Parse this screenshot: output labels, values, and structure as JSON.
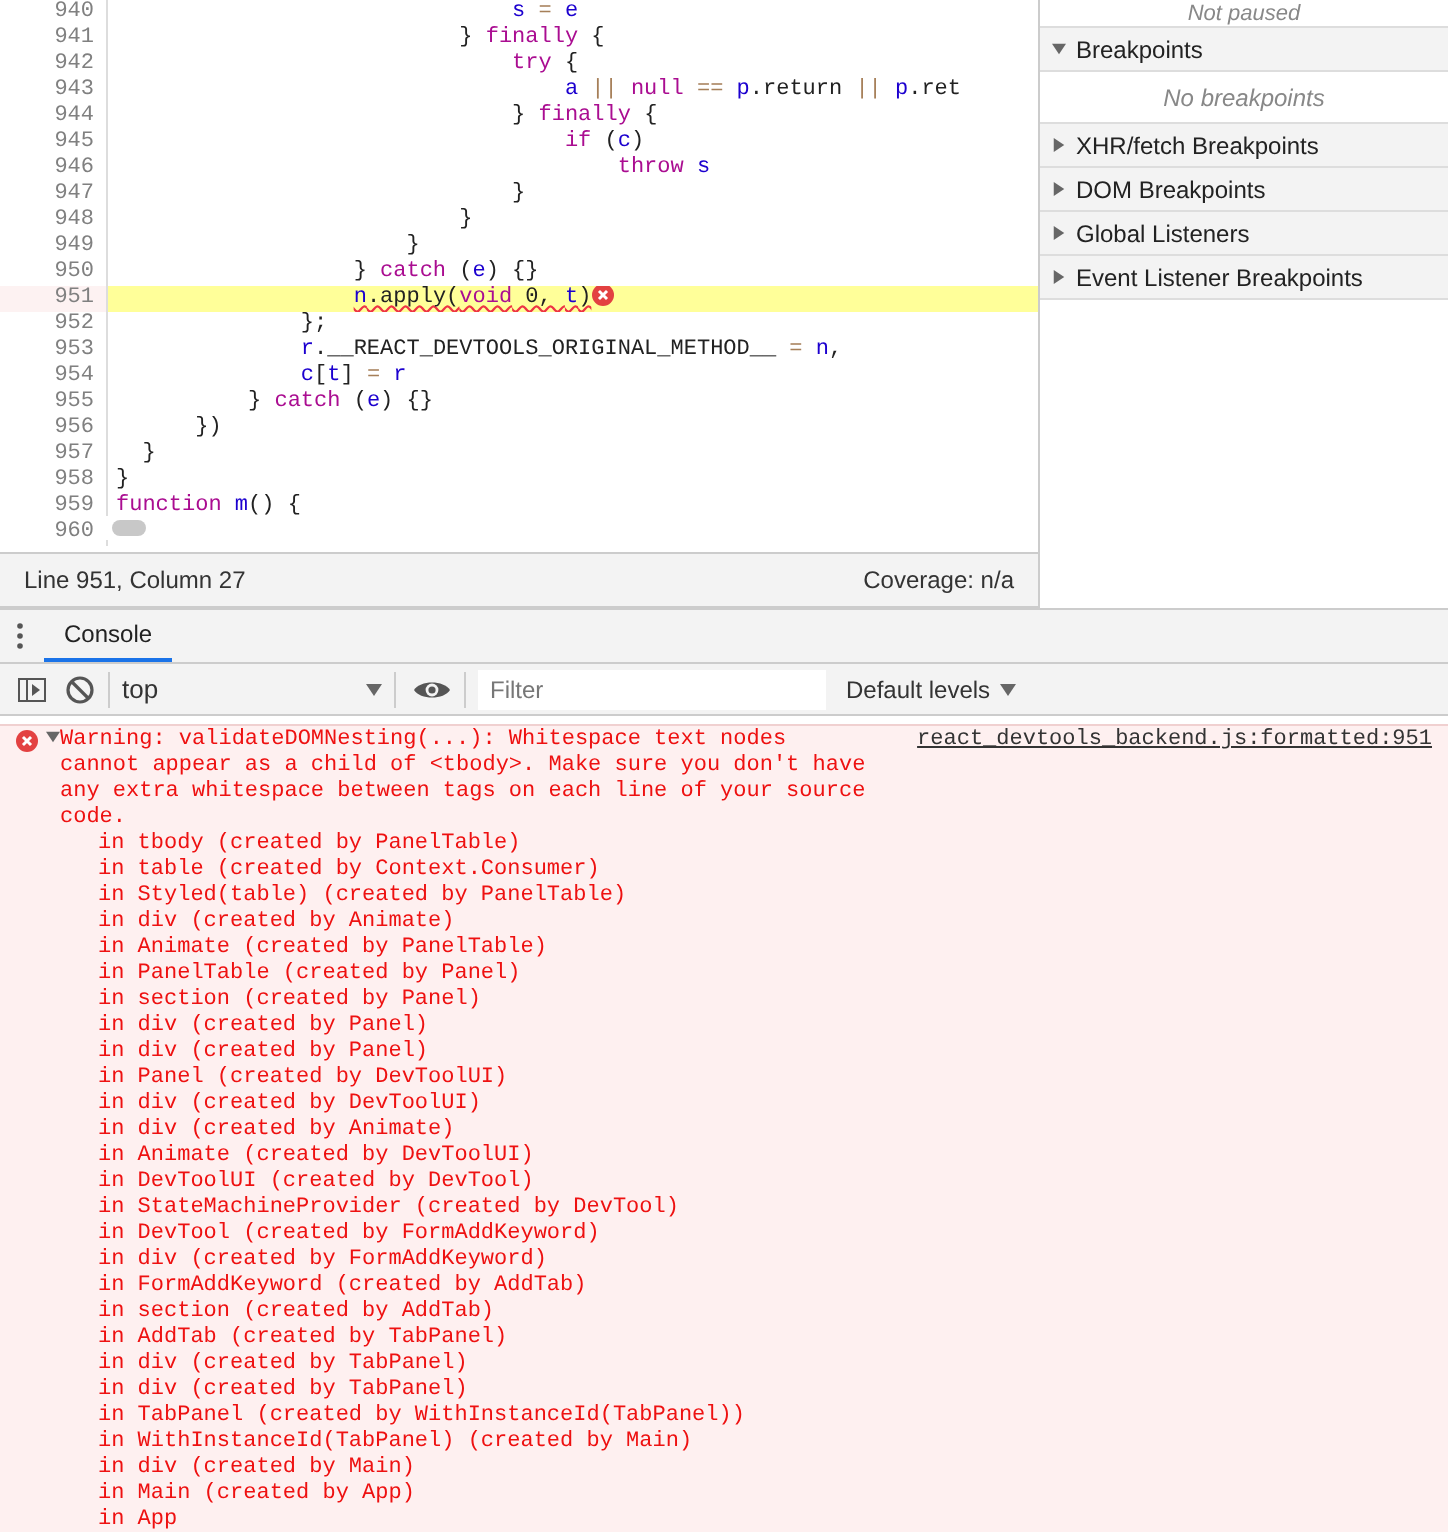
{
  "editor": {
    "lines": [
      {
        "number": "940",
        "selected": false,
        "error": false,
        "tokens": [
          {
            "t": "                              s",
            "kind": "id"
          },
          {
            "t": " =",
            "kind": "op"
          },
          {
            "t": " e",
            "kind": "id"
          }
        ]
      },
      {
        "number": "941",
        "selected": false,
        "error": false,
        "tokens": [
          {
            "t": "                          } ",
            "kind": "plain"
          },
          {
            "t": "finally",
            "kind": "kw"
          },
          {
            "t": " {",
            "kind": "plain"
          }
        ]
      },
      {
        "number": "942",
        "selected": false,
        "error": false,
        "tokens": [
          {
            "t": "                              try",
            "kind": "kw"
          },
          {
            "t": " {",
            "kind": "plain"
          }
        ]
      },
      {
        "number": "943",
        "selected": false,
        "error": false,
        "tokens": [
          {
            "t": "                                  a",
            "kind": "id"
          },
          {
            "t": " ||",
            "kind": "op"
          },
          {
            "t": " null",
            "kind": "kw"
          },
          {
            "t": " ==",
            "kind": "op"
          },
          {
            "t": " p",
            "kind": "id"
          },
          {
            "t": ".return ",
            "kind": "plain"
          },
          {
            "t": "||",
            "kind": "op"
          },
          {
            "t": " p",
            "kind": "id"
          },
          {
            "t": ".ret",
            "kind": "plain"
          }
        ]
      },
      {
        "number": "944",
        "selected": false,
        "error": false,
        "tokens": [
          {
            "t": "                              } ",
            "kind": "plain"
          },
          {
            "t": "finally",
            "kind": "kw"
          },
          {
            "t": " {",
            "kind": "plain"
          }
        ]
      },
      {
        "number": "945",
        "selected": false,
        "error": false,
        "tokens": [
          {
            "t": "                                  if",
            "kind": "kw"
          },
          {
            "t": " (",
            "kind": "plain"
          },
          {
            "t": "c",
            "kind": "id"
          },
          {
            "t": ")",
            "kind": "plain"
          }
        ]
      },
      {
        "number": "946",
        "selected": false,
        "error": false,
        "tokens": [
          {
            "t": "                                      throw",
            "kind": "kw"
          },
          {
            "t": " s",
            "kind": "id"
          }
        ]
      },
      {
        "number": "947",
        "selected": false,
        "error": false,
        "tokens": [
          {
            "t": "                              }",
            "kind": "plain"
          }
        ]
      },
      {
        "number": "948",
        "selected": false,
        "error": false,
        "tokens": [
          {
            "t": "                          }",
            "kind": "plain"
          }
        ]
      },
      {
        "number": "949",
        "selected": false,
        "error": false,
        "tokens": [
          {
            "t": "                      }",
            "kind": "plain"
          }
        ]
      },
      {
        "number": "950",
        "selected": false,
        "error": false,
        "tokens": [
          {
            "t": "                  } ",
            "kind": "plain"
          },
          {
            "t": "catch",
            "kind": "kw"
          },
          {
            "t": " (",
            "kind": "plain"
          },
          {
            "t": "e",
            "kind": "id"
          },
          {
            "t": ") {}",
            "kind": "plain"
          }
        ]
      },
      {
        "number": "951",
        "selected": true,
        "error": true,
        "tokens": [
          {
            "t": "                  n",
            "kind": "id"
          },
          {
            "t": ".apply(",
            "kind": "plain"
          },
          {
            "t": "void",
            "kind": "kw"
          },
          {
            "t": " 0, ",
            "kind": "plain"
          },
          {
            "t": "t",
            "kind": "id"
          },
          {
            "t": ")",
            "kind": "plain"
          }
        ]
      },
      {
        "number": "952",
        "selected": false,
        "error": false,
        "tokens": [
          {
            "t": "              };",
            "kind": "plain"
          }
        ]
      },
      {
        "number": "953",
        "selected": false,
        "error": false,
        "tokens": [
          {
            "t": "              r",
            "kind": "id"
          },
          {
            "t": ".__REACT_DEVTOOLS_ORIGINAL_METHOD__ ",
            "kind": "plain"
          },
          {
            "t": "=",
            "kind": "op"
          },
          {
            "t": " n",
            "kind": "id"
          },
          {
            "t": ",",
            "kind": "plain"
          }
        ]
      },
      {
        "number": "954",
        "selected": false,
        "error": false,
        "tokens": [
          {
            "t": "              c",
            "kind": "id"
          },
          {
            "t": "[",
            "kind": "plain"
          },
          {
            "t": "t",
            "kind": "id"
          },
          {
            "t": "] ",
            "kind": "plain"
          },
          {
            "t": "=",
            "kind": "op"
          },
          {
            "t": " r",
            "kind": "id"
          }
        ]
      },
      {
        "number": "955",
        "selected": false,
        "error": false,
        "tokens": [
          {
            "t": "          } ",
            "kind": "plain"
          },
          {
            "t": "catch",
            "kind": "kw"
          },
          {
            "t": " (",
            "kind": "plain"
          },
          {
            "t": "e",
            "kind": "id"
          },
          {
            "t": ") {}",
            "kind": "plain"
          }
        ]
      },
      {
        "number": "956",
        "selected": false,
        "error": false,
        "tokens": [
          {
            "t": "      })",
            "kind": "plain"
          }
        ]
      },
      {
        "number": "957",
        "selected": false,
        "error": false,
        "tokens": [
          {
            "t": "  }",
            "kind": "plain"
          }
        ]
      },
      {
        "number": "958",
        "selected": false,
        "error": false,
        "tokens": [
          {
            "t": "}",
            "kind": "plain"
          }
        ]
      },
      {
        "number": "959",
        "selected": false,
        "error": false,
        "tokens": [
          {
            "t": "function",
            "kind": "kw"
          },
          {
            "t": " m",
            "kind": "id"
          },
          {
            "t": "() {",
            "kind": "plain"
          }
        ]
      },
      {
        "number": "960",
        "selected": false,
        "error": false
      }
    ]
  },
  "status_bar": {
    "position": "Line 951, Column 27",
    "coverage": "Coverage: n/a"
  },
  "sidebar": {
    "paused_state": "Not paused",
    "sections": [
      {
        "label": "Breakpoints",
        "expanded": true,
        "empty_text": "No breakpoints"
      },
      {
        "label": "XHR/fetch Breakpoints",
        "expanded": false
      },
      {
        "label": "DOM Breakpoints",
        "expanded": false
      },
      {
        "label": "Global Listeners",
        "expanded": false
      },
      {
        "label": "Event Listener Breakpoints",
        "expanded": false
      }
    ]
  },
  "drawer": {
    "tabs": [
      {
        "label": "Console",
        "selected": true
      }
    ]
  },
  "console_toolbar": {
    "context": "top",
    "filter": {
      "placeholder": "Filter"
    },
    "levels": "Default levels"
  },
  "console": {
    "messages": [
      {
        "kind": "error",
        "expanded": true,
        "text": "Warning: validateDOMNesting(...): Whitespace text nodes cannot appear as a child of <tbody>. Make sure you don't have any extra whitespace between tags on each line of your source code.",
        "source": "react_devtools_backend.js:formatted:951",
        "stack": [
          "in tbody (created by PanelTable)",
          "in table (created by Context.Consumer)",
          "in Styled(table) (created by PanelTable)",
          "in div (created by Animate)",
          "in Animate (created by PanelTable)",
          "in PanelTable (created by Panel)",
          "in section (created by Panel)",
          "in div (created by Panel)",
          "in div (created by Panel)",
          "in Panel (created by DevToolUI)",
          "in div (created by DevToolUI)",
          "in div (created by Animate)",
          "in Animate (created by DevToolUI)",
          "in DevToolUI (created by DevTool)",
          "in StateMachineProvider (created by DevTool)",
          "in DevTool (created by FormAddKeyword)",
          "in div (created by FormAddKeyword)",
          "in FormAddKeyword (created by AddTab)",
          "in section (created by AddTab)",
          "in AddTab (created by TabPanel)",
          "in div (created by TabPanel)",
          "in div (created by TabPanel)",
          "in TabPanel (created by WithInstanceId(TabPanel))",
          "in WithInstanceId(TabPanel) (created by Main)",
          "in div (created by Main)",
          "in Main (created by App)",
          "in App"
        ]
      }
    ]
  }
}
